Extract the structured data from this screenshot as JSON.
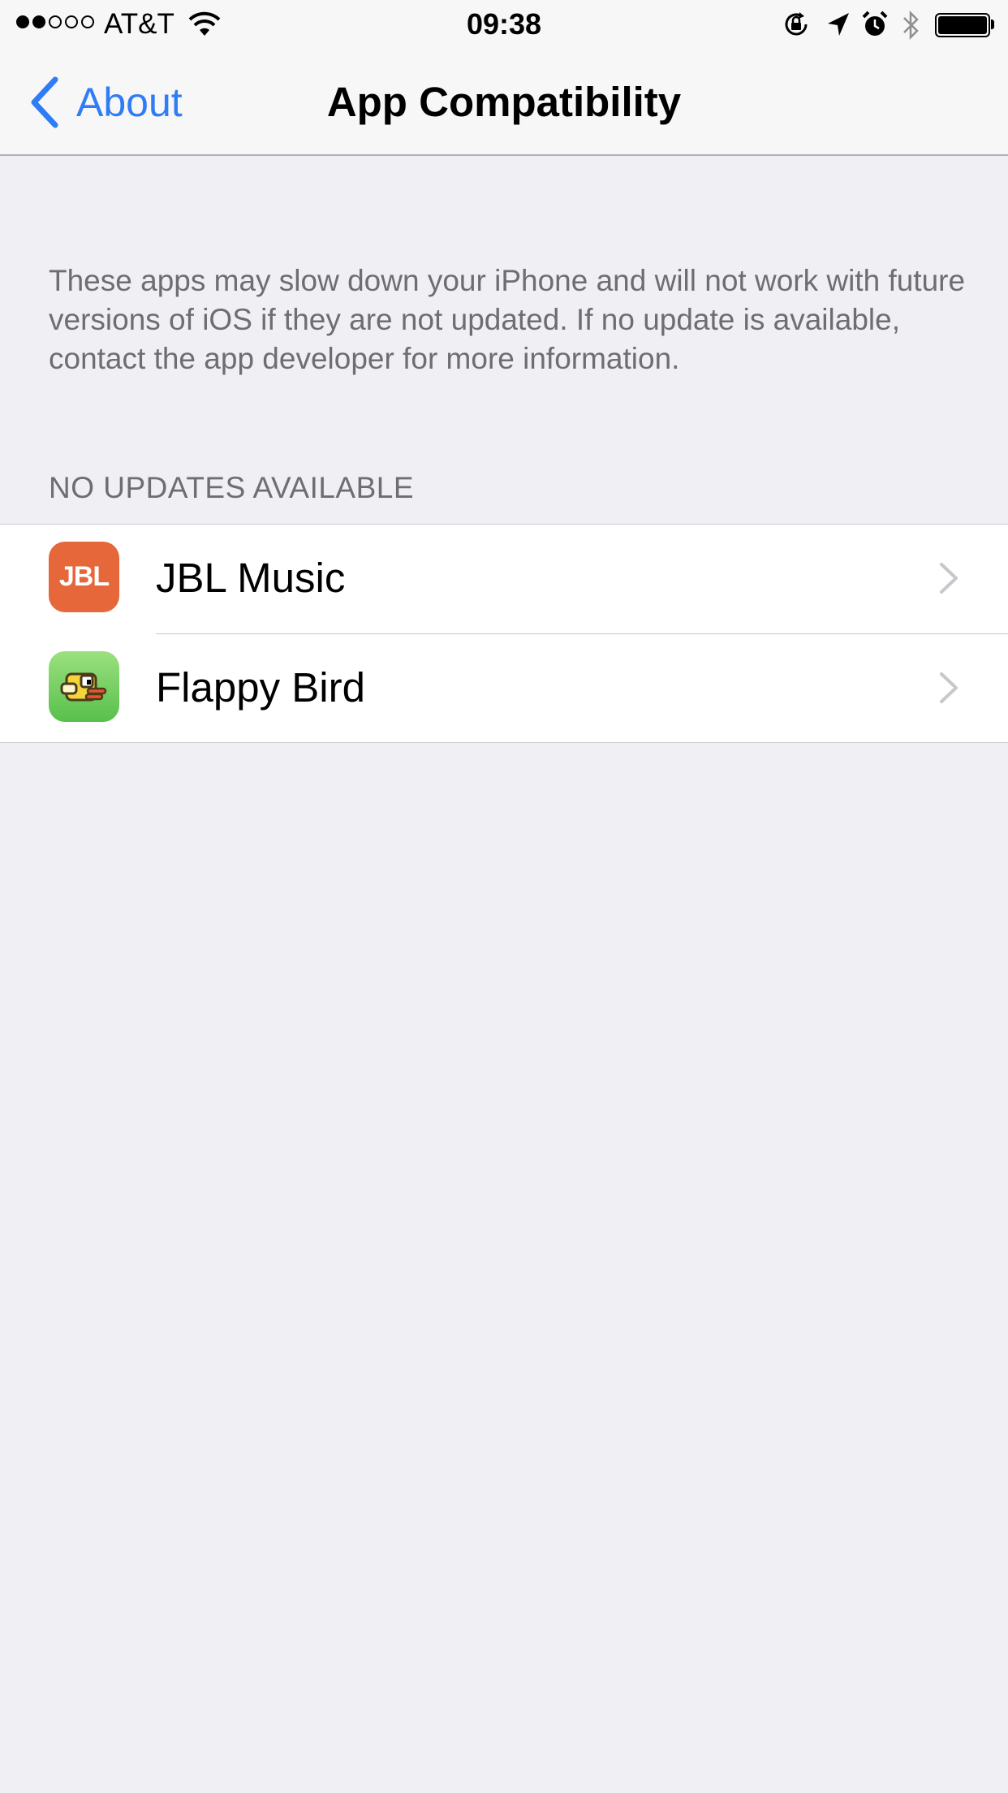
{
  "status_bar": {
    "signal_dots": [
      true,
      true,
      false,
      false,
      false
    ],
    "carrier": "AT&T",
    "time": "09:38",
    "icons": [
      "wifi-icon",
      "orientation-lock-icon",
      "location-arrow-icon",
      "alarm-icon",
      "bluetooth-icon",
      "battery-icon"
    ],
    "battery_level": 1.0
  },
  "nav": {
    "back_label": "About",
    "title": "App Compatibility",
    "tint_color": "#2f7df6"
  },
  "content": {
    "description": "These apps may slow down your iPhone and will not work with future versions of iOS if they are not updated. If no update is available, contact the app developer for more information.",
    "section_header": "NO UPDATES AVAILABLE",
    "apps": [
      {
        "name": "JBL Music",
        "icon": "jbl-music-icon",
        "icon_text": "JBL",
        "icon_color": "#e6683a"
      },
      {
        "name": "Flappy Bird",
        "icon": "flappy-bird-icon",
        "icon_color": "#6cc85a"
      }
    ]
  },
  "colors": {
    "background": "#efeff4",
    "secondary_text": "#6d6d72",
    "separator": "#c8c7cc"
  }
}
